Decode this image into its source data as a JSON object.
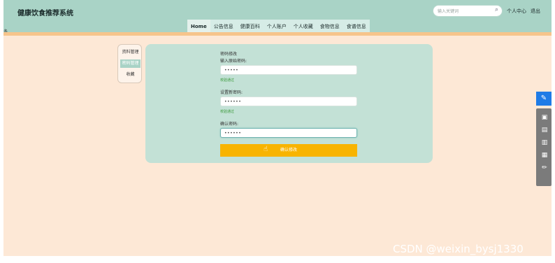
{
  "header": {
    "brand": "健康饮食推荐系统",
    "search_placeholder": "输入关键词",
    "links": [
      "个人中心",
      "退出"
    ],
    "edge_glyph": "多"
  },
  "nav": {
    "items": [
      "Home",
      "公告信息",
      "健康百科",
      "个人账户",
      "个人收藏",
      "食物信息",
      "食谱信息"
    ],
    "active_index": 0
  },
  "sidemenu": {
    "items": [
      "资料管理",
      "密码管理",
      "收藏"
    ],
    "active_index": 1
  },
  "form": {
    "title": "密码修改",
    "old_label": "输入原始密码:",
    "old_value": "•••••",
    "old_status": "校验通过",
    "new_label": "设置新密码:",
    "new_value": "••••••",
    "new_status": "校验通过",
    "confirm_label": "确认密码:",
    "confirm_value": "••••••",
    "submit_label": "确认修改"
  },
  "float_bar": {
    "icons": [
      "edit-icon",
      "camera-icon",
      "briefcase-icon",
      "document-icon",
      "picture-icon",
      "pen-icon"
    ]
  },
  "watermark": "CSDN @weixin_bysj1330",
  "colors": {
    "header_bg": "#a9d3c6",
    "page_bg": "#fde8d6",
    "accent_orange": "#f8b400",
    "card_bg": "#c3e1d6",
    "float_blue": "#1e7be6"
  }
}
